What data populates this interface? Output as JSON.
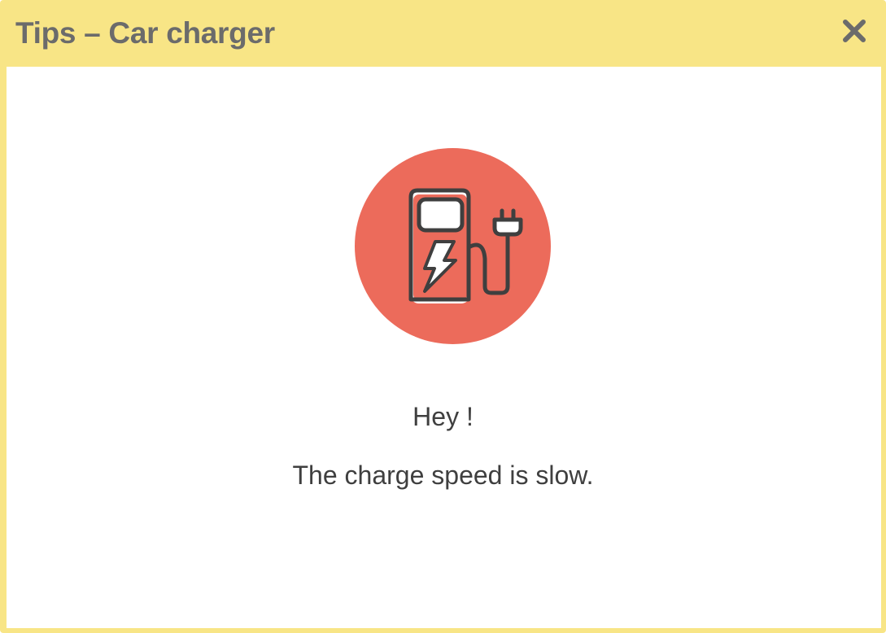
{
  "dialog": {
    "title": "Tips – Car charger",
    "close_icon": "close-icon",
    "illustration_icon": "ev-charging-station-icon",
    "greeting": "Hey !",
    "message": "The charge speed is slow."
  },
  "colors": {
    "header_background": "#f8e586",
    "title_text": "#6b6b6b",
    "icon_circle": "#ec6b5b",
    "body_text": "#3f3f3f"
  }
}
